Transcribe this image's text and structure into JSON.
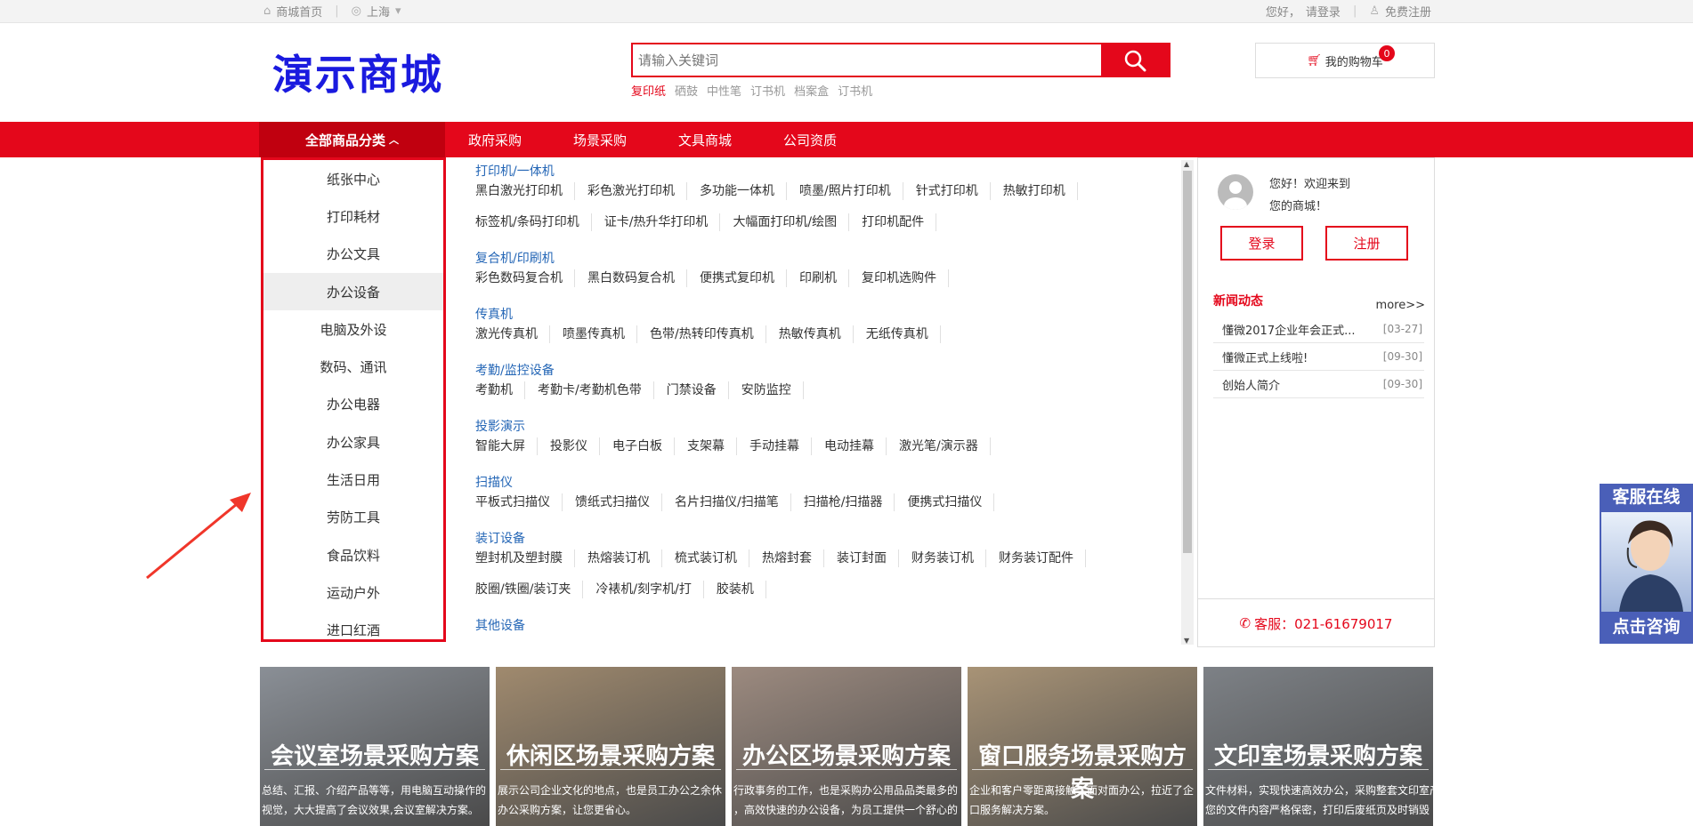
{
  "topbar": {
    "home": "商城首页",
    "city": "上海",
    "greeting": "您好，",
    "login": "请登录",
    "register": "免费注册"
  },
  "header": {
    "logo": "演示商城",
    "search_placeholder": "请输入关键词",
    "hot_words": [
      "复印纸",
      "硒鼓",
      "中性笔",
      "订书机",
      "档案盒",
      "订书机"
    ],
    "cart_label": "我的购物车",
    "cart_count": "0"
  },
  "nav": {
    "all_categories": "全部商品分类",
    "links": [
      "政府采购",
      "场景采购",
      "文具商城",
      "公司资质"
    ]
  },
  "categories": [
    "纸张中心",
    "打印耗材",
    "办公文具",
    "办公设备",
    "电脑及外设",
    "数码、通讯",
    "办公电器",
    "办公家具",
    "生活日用",
    "劳防工具",
    "食品饮料",
    "运动户外",
    "进口红酒"
  ],
  "subcategories": [
    {
      "title": "打印机/一体机",
      "rows": [
        [
          "黑白激光打印机",
          "彩色激光打印机",
          "多功能一体机",
          "喷墨/照片打印机",
          "针式打印机",
          "热敏打印机"
        ],
        [
          "标签机/条码打印机",
          "证卡/热升华打印机",
          "大幅面打印机/绘图",
          "打印机配件"
        ]
      ]
    },
    {
      "title": "复合机/印刷机",
      "rows": [
        [
          "彩色数码复合机",
          "黑白数码复合机",
          "便携式复印机",
          "印刷机",
          "复印机选购件"
        ]
      ]
    },
    {
      "title": "传真机",
      "rows": [
        [
          "激光传真机",
          "喷墨传真机",
          "色带/热转印传真机",
          "热敏传真机",
          "无纸传真机"
        ]
      ]
    },
    {
      "title": "考勤/监控设备",
      "rows": [
        [
          "考勤机",
          "考勤卡/考勤机色带",
          "门禁设备",
          "安防监控"
        ]
      ]
    },
    {
      "title": "投影演示",
      "rows": [
        [
          "智能大屏",
          "投影仪",
          "电子白板",
          "支架幕",
          "手动挂幕",
          "电动挂幕",
          "激光笔/演示器"
        ]
      ]
    },
    {
      "title": "扫描仪",
      "rows": [
        [
          "平板式扫描仪",
          "馈纸式扫描仪",
          "名片扫描仪/扫描笔",
          "扫描枪/扫描器",
          "便携式扫描仪"
        ]
      ]
    },
    {
      "title": "装订设备",
      "rows": [
        [
          "塑封机及塑封膜",
          "热熔装订机",
          "梳式装订机",
          "热熔封套",
          "装订封面",
          "财务装订机",
          "财务装订配件"
        ],
        [
          "胶圈/铁圈/装订夹",
          "冷裱机/刻字机/打",
          "胶装机"
        ]
      ]
    },
    {
      "title": "其他设备",
      "rows": []
    }
  ],
  "user": {
    "welcome_line1": "您好！欢迎来到",
    "welcome_line2": "您的商城！",
    "login_btn": "登录",
    "register_btn": "注册",
    "news_title": "新闻动态",
    "more": "more>>",
    "news": [
      {
        "title": "懂微2017企业年会正式...",
        "date": "[03-27]"
      },
      {
        "title": "懂微正式上线啦!",
        "date": "[09-30]"
      },
      {
        "title": "创始人简介",
        "date": "[09-30]"
      }
    ],
    "hotline": "客服：021-61679017"
  },
  "service": {
    "top": "客服在线",
    "bottom": "点击咨询"
  },
  "scenes": [
    {
      "title": "会议室场景采购方案",
      "desc1": "总结、汇报、介绍产品等等，用电脑互动操作的",
      "desc2": "视觉，大大提高了会议效果,会议室解决方案。",
      "color": "#8a8f96"
    },
    {
      "title": "休闲区场景采购方案",
      "desc1": "展示公司企业文化的地点，也是员工办公之余休",
      "desc2": "办公采购方案，让您更省心。",
      "color": "#a08a6e"
    },
    {
      "title": "办公区场景采购方案",
      "desc1": "行政事务的工作，也是采购办公用品品类最多的",
      "desc2": "，高效快速的办公设备，为员工提供一个舒心的",
      "color": "#9c8a7f"
    },
    {
      "title": "窗口服务场景采购方案",
      "desc1": "企业和客户零距离接触，面对面办公，拉近了企",
      "desc2": "口服务解决方案。",
      "color": "#a89376"
    },
    {
      "title": "文印室场景采购方案",
      "desc1": "文件材料，实现快速高效办公，采购整套文印室产",
      "desc2": "您的文件内容严格保密，打印后废纸页及时销毁",
      "color": "#7d8186"
    }
  ]
}
